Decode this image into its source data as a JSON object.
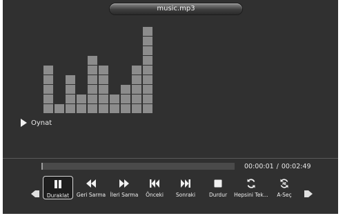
{
  "player": {
    "track_title": "music.mp3",
    "status_label": "Oynat",
    "progress": 0.007,
    "time": {
      "elapsed": "00:00:01",
      "separator": "/",
      "total": "00:02:49"
    },
    "equalizer_levels": [
      5,
      1,
      4,
      2,
      6,
      5,
      2,
      3,
      5,
      9
    ]
  },
  "controls": [
    {
      "name": "pause-button",
      "icon": "pause-icon",
      "label": "Duraklat",
      "selected": true
    },
    {
      "name": "rewind-button",
      "icon": "rewind-icon",
      "label": "Geri Sarma"
    },
    {
      "name": "fast-forward-button",
      "icon": "fast-forward-icon",
      "label": "İleri Sarma"
    },
    {
      "name": "previous-button",
      "icon": "skip-previous-icon",
      "label": "Önceki"
    },
    {
      "name": "next-button",
      "icon": "skip-next-icon",
      "label": "Sonraki"
    },
    {
      "name": "stop-button",
      "icon": "stop-icon",
      "label": "Durdur"
    },
    {
      "name": "repeat-all-button",
      "icon": "repeat-icon",
      "label": "Hepsini Tek..."
    },
    {
      "name": "ab-repeat-button",
      "icon": "ab-repeat-icon",
      "label": "A-Seç"
    }
  ],
  "colors": {
    "background": "#303030",
    "accent": "#f0f0f0",
    "bar": "#8c8c8c",
    "progress": "#9d9d9d"
  }
}
